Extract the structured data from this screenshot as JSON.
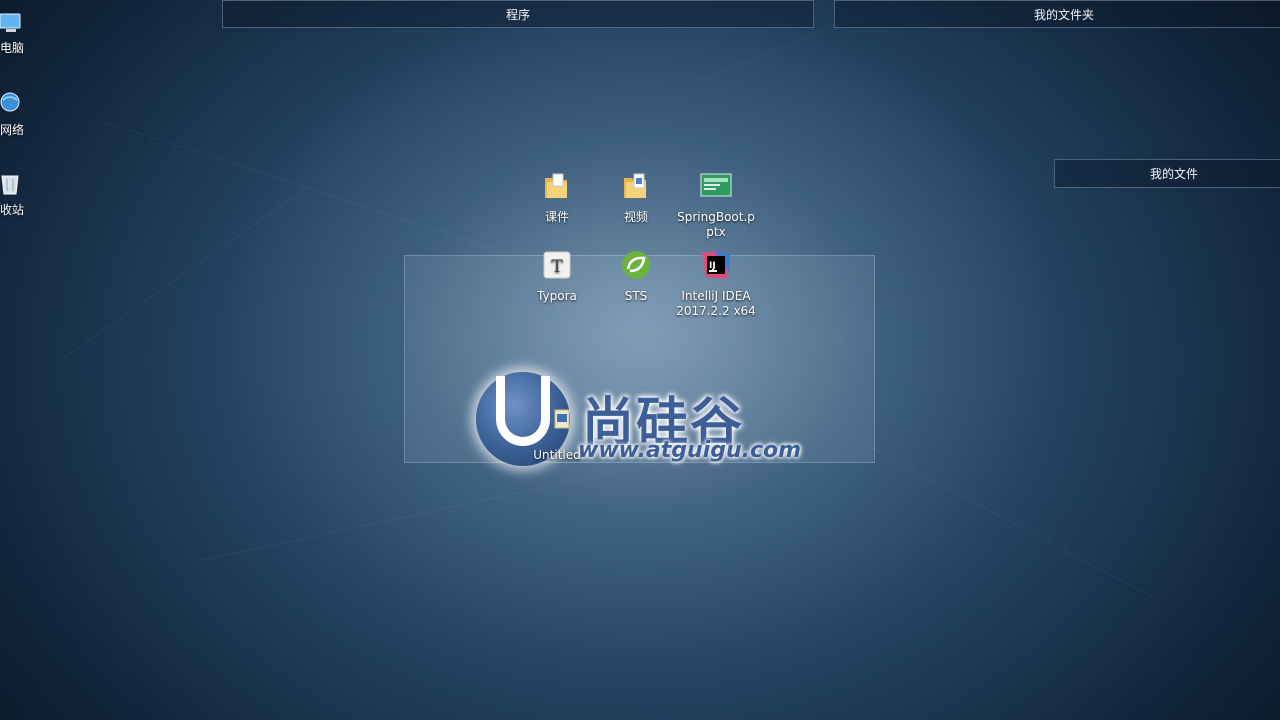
{
  "fences": {
    "programs": "程序",
    "my_folder": "我的文件夹",
    "my_files": "我的文件"
  },
  "left_icons": [
    {
      "label": "电脑",
      "icon": "computer-icon"
    },
    {
      "label": "网络",
      "icon": "network-icon"
    },
    {
      "label": "收站",
      "icon": "recycle-bin-icon"
    }
  ],
  "desktop_icons": [
    {
      "label": "课件",
      "icon": "folder-icon"
    },
    {
      "label": "视频",
      "icon": "folder-icon"
    },
    {
      "label": "SpringBoot.pptx",
      "icon": "pptx-file-icon"
    },
    {
      "label": "Typora",
      "icon": "typora-icon"
    },
    {
      "label": "STS",
      "icon": "sts-icon"
    },
    {
      "label": "IntelliJ IDEA 2017.2.2 x64",
      "icon": "intellij-idea-icon"
    },
    {
      "label": "Untitled",
      "icon": "document-icon"
    }
  ],
  "watermark": {
    "cn": "尚硅谷",
    "url": "www.atguigu.com"
  }
}
